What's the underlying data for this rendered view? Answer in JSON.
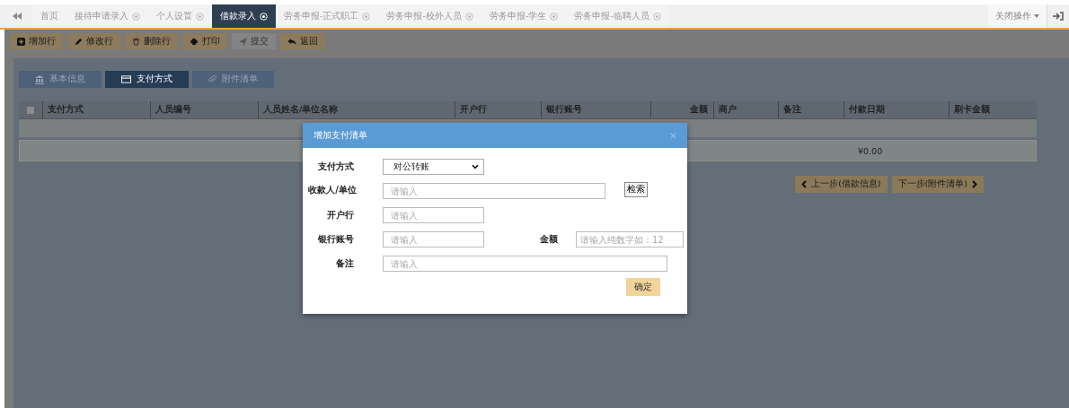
{
  "top_tabs": [
    {
      "label": "首页",
      "selected": false,
      "closable": false
    },
    {
      "label": "接待申请录入",
      "selected": false,
      "closable": true
    },
    {
      "label": "个人设置",
      "selected": false,
      "closable": true
    },
    {
      "label": "借款录入",
      "selected": true,
      "closable": true
    },
    {
      "label": "劳务申报-正式职工",
      "selected": false,
      "closable": true
    },
    {
      "label": "劳务申报-校外人员",
      "selected": false,
      "closable": true
    },
    {
      "label": "劳务申报-学生",
      "selected": false,
      "closable": true
    },
    {
      "label": "劳务申报-临聘人员",
      "selected": false,
      "closable": true
    }
  ],
  "close_menu": "关闭操作",
  "toolbar": [
    {
      "label": "增加行",
      "disabled": false
    },
    {
      "label": "修改行",
      "disabled": false
    },
    {
      "label": "删除行",
      "disabled": false
    },
    {
      "label": "打印",
      "disabled": false
    },
    {
      "label": "提交",
      "disabled": true
    },
    {
      "label": "返回",
      "disabled": false
    }
  ],
  "section_tabs": [
    {
      "label": "基本信息",
      "selected": false
    },
    {
      "label": "支付方式",
      "selected": true
    },
    {
      "label": "附件清单",
      "selected": false
    }
  ],
  "table": {
    "select_all_checked": false,
    "columns": [
      "支付方式",
      "人员编号",
      "人员姓名/单位名称",
      "开户行",
      "银行账号",
      "金额",
      "商户",
      "备注",
      "付款日期",
      "刷卡金额"
    ],
    "total": "¥0.00"
  },
  "step_buttons": [
    "上一步(借款信息)",
    "下一步(附件清单)"
  ],
  "dialog": {
    "title": "增加支付清单",
    "payment_method": {
      "label": "支付方式",
      "value": "对公转账"
    },
    "payee": {
      "label": "收款人/单位",
      "placeholder": "请输入",
      "search_button": "检索"
    },
    "bank": {
      "label": "开户行",
      "placeholder": "请输入"
    },
    "account": {
      "label": "银行账号",
      "placeholder": "请输入"
    },
    "amount": {
      "label": "金额",
      "placeholder": "请输入纯数字如：12"
    },
    "remark": {
      "label": "备注",
      "placeholder": "请输入"
    },
    "confirm": "确定"
  }
}
